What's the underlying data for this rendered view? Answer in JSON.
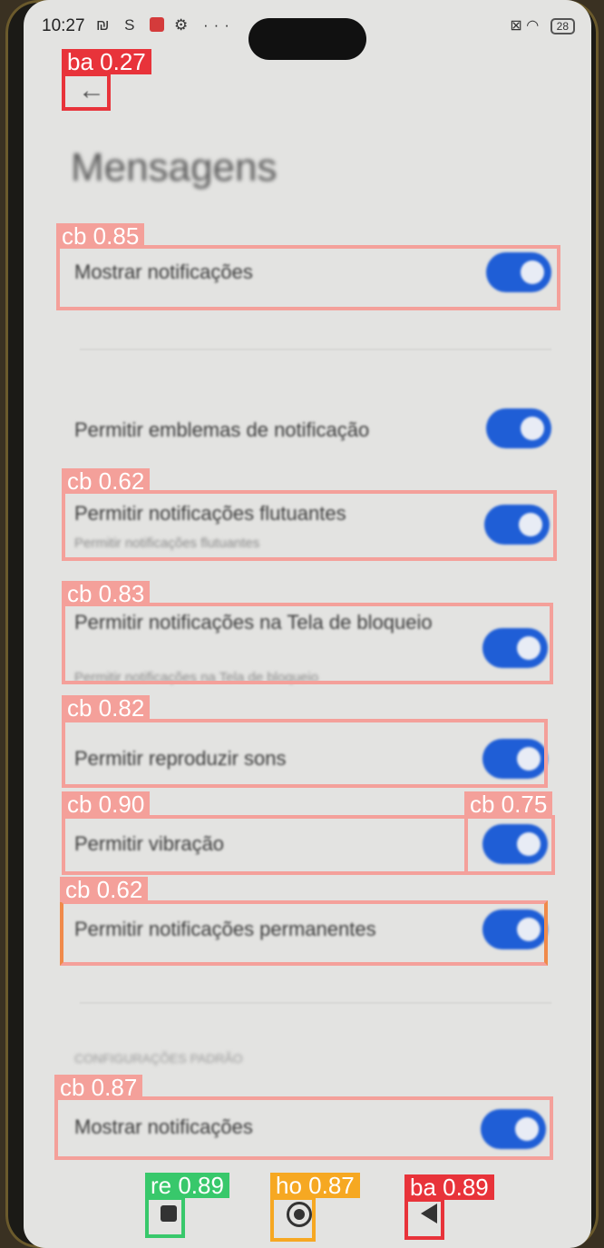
{
  "status_bar": {
    "time": "10:27",
    "left_icons": "₪ S",
    "battery": "28",
    "icon_names": [
      "nfc-icon",
      "s-icon",
      "mail-icon",
      "gear-icon",
      "more-icon",
      "sim-icon",
      "wifi-icon",
      "battery-icon"
    ]
  },
  "page": {
    "back_glyph": "←",
    "title": "Mensagens"
  },
  "settings": [
    {
      "label": "Mostrar notificações",
      "sub": "",
      "on": true
    },
    {
      "label": "Permitir emblemas de notificação",
      "sub": "",
      "on": true
    },
    {
      "label": "Permitir notificações flutuantes",
      "sub": "Permitir notificações flutuantes",
      "on": true
    },
    {
      "label": "Permitir notificações na Tela de bloqueio",
      "sub": "Permitir notificações na Tela de bloqueio",
      "on": true
    },
    {
      "label": "Permitir reproduzir sons",
      "sub": "",
      "on": true
    },
    {
      "label": "Permitir vibração",
      "sub": "",
      "on": true
    },
    {
      "label": "Permitir notificações permanentes",
      "sub": "",
      "on": true
    },
    {
      "label": "Mostrar notificações",
      "sub": "",
      "on": true
    }
  ],
  "section_header": "CONFIGURAÇÕES PADRÃO",
  "navbar": {
    "items": [
      "recent-apps",
      "home",
      "back"
    ]
  },
  "detections": [
    {
      "tag": "ba 0.27",
      "color": "#e8333a"
    },
    {
      "tag": "cb 0.85",
      "color": "#f4a09a"
    },
    {
      "tag": "cb 0.62",
      "color": "#f4a09a"
    },
    {
      "tag": "cb 0.83",
      "color": "#f4a09a"
    },
    {
      "tag": "cb 0.82",
      "color": "#f4a09a"
    },
    {
      "tag": "cb 0.90",
      "color": "#f4a09a"
    },
    {
      "tag": "cb 0.75",
      "color": "#f4a09a"
    },
    {
      "tag": "cb 0.62",
      "color": "#f08a4a"
    },
    {
      "tag": "cb 0.87",
      "color": "#f4a09a"
    },
    {
      "tag": "re 0.89",
      "color": "#38c86b"
    },
    {
      "tag": "ho 0.87",
      "color": "#f6a822"
    },
    {
      "tag": "ba 0.89",
      "color": "#e8333a"
    }
  ],
  "colors": {
    "toggle_on": "#1f5ed6",
    "screen_bg": "#e3e3e1"
  }
}
